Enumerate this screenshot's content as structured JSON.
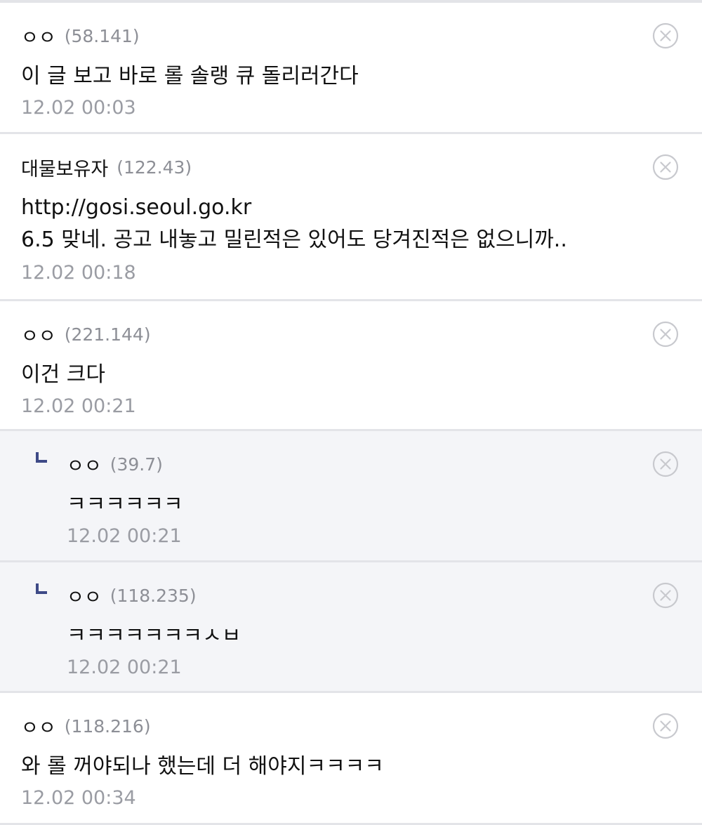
{
  "colors": {
    "divider": "#e3e4e8",
    "reply_background": "#f4f5f8",
    "meta_gray": "#9a9ca3",
    "reply_marker": "#3e4a87",
    "delete_icon": "#c8c9ce"
  },
  "comments": [
    {
      "nickname": "ㅇㅇ",
      "ip": "(58.141)",
      "lines": [
        "이 글 보고 바로 롤 솔랭 큐 돌리러간다"
      ],
      "date": "12.02 00:03",
      "is_reply": false,
      "delete_icon": "close-circle-icon"
    },
    {
      "nickname": "대물보유자",
      "ip": "(122.43)",
      "lines": [
        "http://gosi.seoul.go.kr",
        "6.5 맞네. 공고 내놓고 밀린적은 있어도 당겨진적은 없으니까.."
      ],
      "date": "12.02 00:18",
      "is_reply": false,
      "delete_icon": "close-circle-icon"
    },
    {
      "nickname": "ㅇㅇ",
      "ip": "(221.144)",
      "lines": [
        "이건 크다"
      ],
      "date": "12.02 00:21",
      "is_reply": false,
      "delete_icon": "close-circle-icon"
    },
    {
      "nickname": "ㅇㅇ",
      "ip": "(39.7)",
      "lines": [
        "ㅋㅋㅋㅋㅋㅋ"
      ],
      "date": "12.02 00:21",
      "is_reply": true,
      "delete_icon": "close-circle-icon"
    },
    {
      "nickname": "ㅇㅇ",
      "ip": "(118.235)",
      "lines": [
        "ㅋㅋㅋㅋㅋㅋㅋㅅㅂ"
      ],
      "date": "12.02 00:21",
      "is_reply": true,
      "delete_icon": "close-circle-icon"
    },
    {
      "nickname": "ㅇㅇ",
      "ip": "(118.216)",
      "lines": [
        "와 롤 꺼야되나 했는데 더 해야지ㅋㅋㅋㅋ"
      ],
      "date": "12.02 00:34",
      "is_reply": false,
      "delete_icon": "close-circle-icon"
    }
  ]
}
